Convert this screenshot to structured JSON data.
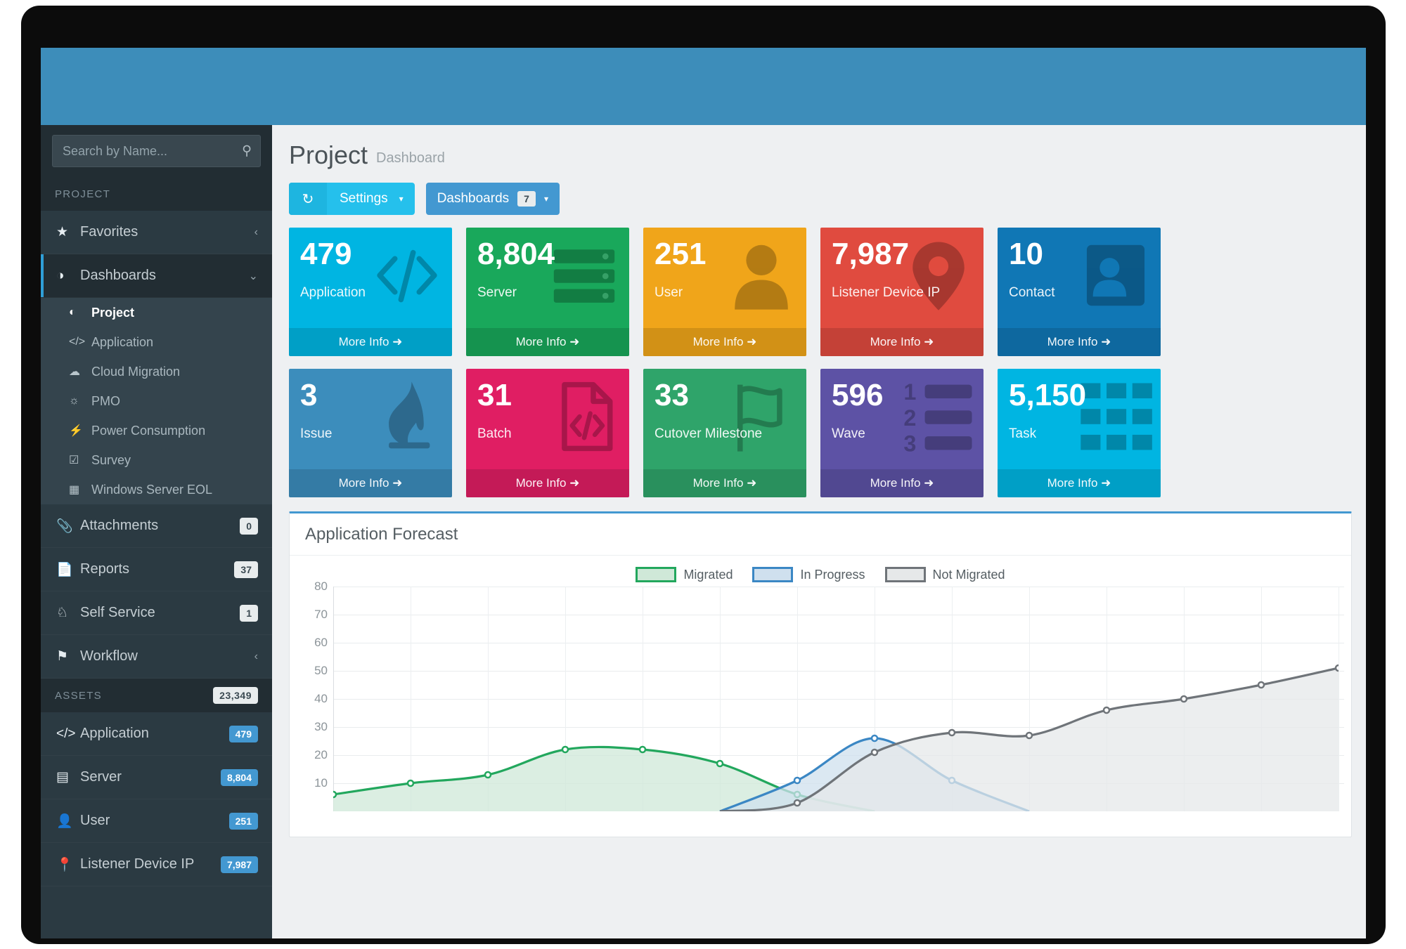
{
  "sidebar": {
    "search": {
      "placeholder": "Search by Name...",
      "value": "",
      "icon": "search-icon"
    },
    "project_section": {
      "label": "PROJECT"
    },
    "favorites": {
      "label": "Favorites",
      "icon": "star-icon",
      "chevron": "‹"
    },
    "dashboards": {
      "label": "Dashboards",
      "icon": "dashboard-icon",
      "chevron": "⌄"
    },
    "dashboard_children": [
      {
        "label": "Project",
        "icon": "pie-chart-icon",
        "current": true
      },
      {
        "label": "Application",
        "icon": "code-icon",
        "current": false
      },
      {
        "label": "Cloud Migration",
        "icon": "cloud-icon",
        "current": false
      },
      {
        "label": "PMO",
        "icon": "lightbulb-icon",
        "current": false
      },
      {
        "label": "Power Consumption",
        "icon": "bolt-icon",
        "current": false
      },
      {
        "label": "Survey",
        "icon": "check-square-icon",
        "current": false
      },
      {
        "label": "Windows Server EOL",
        "icon": "windows-icon",
        "current": false
      }
    ],
    "items": [
      {
        "label": "Attachments",
        "icon": "paperclip-icon",
        "badge": "0",
        "chevron": ""
      },
      {
        "label": "Reports",
        "icon": "report-icon",
        "badge": "37",
        "chevron": ""
      },
      {
        "label": "Self Service",
        "icon": "self-service-icon",
        "badge": "1",
        "chevron": ""
      },
      {
        "label": "Workflow",
        "icon": "flag-icon",
        "badge": "",
        "chevron": "‹"
      }
    ],
    "assets_section": {
      "label": "ASSETS",
      "badge": "23,349"
    },
    "assets": [
      {
        "label": "Application",
        "icon": "code-icon",
        "badge": "479"
      },
      {
        "label": "Server",
        "icon": "server-icon",
        "badge": "8,804"
      },
      {
        "label": "User",
        "icon": "user-icon",
        "badge": "251"
      },
      {
        "label": "Listener Device IP",
        "icon": "map-pin-icon",
        "badge": "7,987"
      }
    ]
  },
  "header": {
    "title": "Project",
    "subtitle": "Dashboard"
  },
  "toolbar": {
    "refresh_icon": "refresh-icon",
    "settings_label": "Settings",
    "settings_caret": "▾",
    "dashboards_label": "Dashboards",
    "dashboards_badge": "7",
    "dashboards_caret": "▾"
  },
  "tiles": [
    {
      "value": "479",
      "label": "Application",
      "more": "More Info",
      "color": "#00b5e2",
      "icon": "code-icon"
    },
    {
      "value": "8,804",
      "label": "Server",
      "more": "More Info",
      "color": "#19a85b",
      "icon": "server-icon"
    },
    {
      "value": "251",
      "label": "User",
      "more": "More Info",
      "color": "#f0a51a",
      "icon": "user-icon"
    },
    {
      "value": "7,987",
      "label": "Listener Device IP",
      "more": "More Info",
      "color": "#e04b3f",
      "icon": "map-pin-icon"
    },
    {
      "value": "10",
      "label": "Contact",
      "more": "More Info",
      "color": "#1077b5",
      "icon": "contact-icon"
    },
    {
      "value": "3",
      "label": "Issue",
      "more": "More Info",
      "color": "#3c8dbc",
      "icon": "flame-icon"
    },
    {
      "value": "31",
      "label": "Batch",
      "more": "More Info",
      "color": "#e01e63",
      "icon": "file-code-icon"
    },
    {
      "value": "33",
      "label": "Cutover Milestone",
      "more": "More Info",
      "color": "#2fa46a",
      "icon": "flag-icon"
    },
    {
      "value": "596",
      "label": "Wave",
      "more": "More Info",
      "color": "#5d52a5",
      "icon": "ordered-list-icon"
    },
    {
      "value": "5,150",
      "label": "Task",
      "more": "More Info",
      "color": "#00b5e2",
      "icon": "grid-icon"
    }
  ],
  "chart_panel": {
    "title": "Application Forecast"
  },
  "chart_data": {
    "type": "area",
    "title": "Application Forecast",
    "xlabel": "",
    "ylabel": "",
    "ylim": [
      0,
      80
    ],
    "yticks": [
      10,
      20,
      30,
      40,
      50,
      60,
      70,
      80
    ],
    "grid": true,
    "legend_position": "top-center",
    "x": [
      1,
      2,
      3,
      4,
      5,
      6,
      7,
      8,
      9,
      10,
      11,
      12,
      13,
      14
    ],
    "series": [
      {
        "name": "Migrated",
        "color": "#22a75d",
        "fill": "#cfe8d8",
        "values": [
          6,
          10,
          13,
          22,
          22,
          17,
          6,
          0,
          0,
          0,
          0,
          0,
          0,
          0
        ]
      },
      {
        "name": "In Progress",
        "color": "#3b87c4",
        "fill": "#cfe0ee",
        "values": [
          0,
          0,
          0,
          0,
          0,
          0,
          11,
          26,
          11,
          0,
          0,
          0,
          0,
          0
        ]
      },
      {
        "name": "Not Migrated",
        "color": "#6f7479",
        "fill": "#e6e8e9",
        "values": [
          0,
          0,
          0,
          0,
          0,
          0,
          3,
          21,
          28,
          27,
          36,
          40,
          45,
          51
        ]
      }
    ]
  }
}
